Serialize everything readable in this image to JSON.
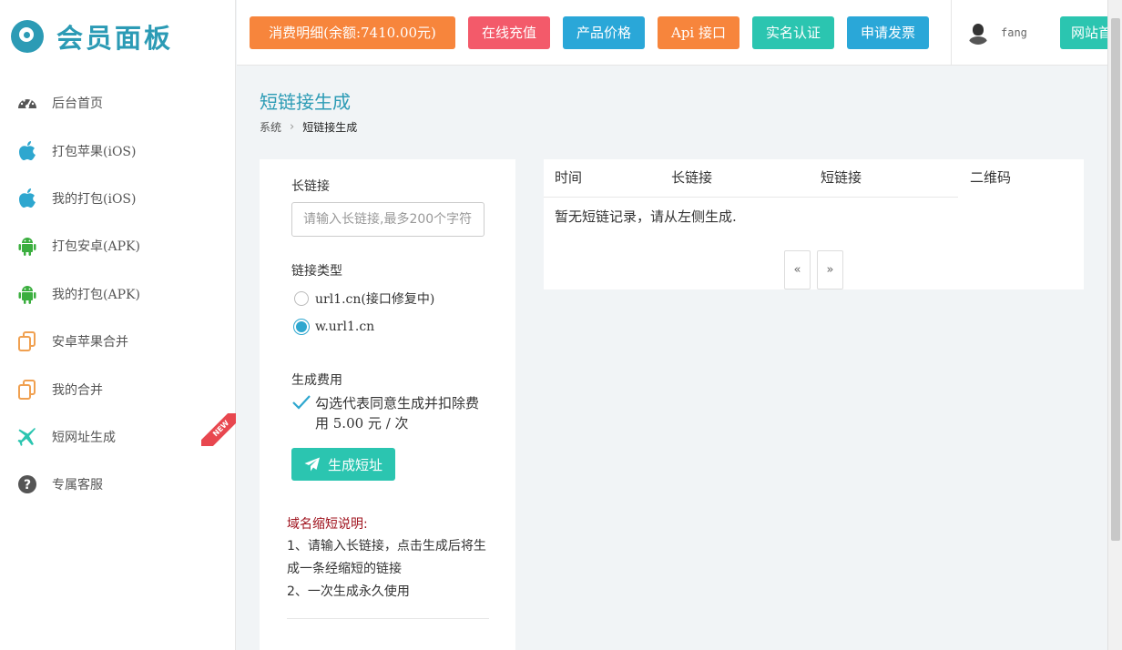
{
  "brand": {
    "title": "会员面板"
  },
  "sidebar": {
    "items": [
      {
        "label": "后台首页",
        "icon": "dashboard-icon"
      },
      {
        "label": "打包苹果(iOS)",
        "icon": "apple-icon"
      },
      {
        "label": "我的打包(iOS)",
        "icon": "apple-icon"
      },
      {
        "label": "打包安卓(APK)",
        "icon": "android-icon"
      },
      {
        "label": "我的打包(APK)",
        "icon": "android-icon"
      },
      {
        "label": "安卓苹果合并",
        "icon": "copy-icon"
      },
      {
        "label": "我的合并",
        "icon": "copy-icon"
      },
      {
        "label": "短网址生成",
        "icon": "plane-icon",
        "badge": "NEW"
      },
      {
        "label": "专属客服",
        "icon": "help-icon"
      }
    ]
  },
  "header": {
    "buttons": [
      {
        "label": "消费明细(余额:7410.00元)",
        "color": "#f7853c"
      },
      {
        "label": "在线充值",
        "color": "#f35a6a"
      },
      {
        "label": "产品价格",
        "color": "#2aa7d8"
      },
      {
        "label": "Api 接口",
        "color": "#f7853c"
      },
      {
        "label": "实名认证",
        "color": "#2bc5b0"
      },
      {
        "label": "申请发票",
        "color": "#2aa7d8"
      }
    ],
    "username": "fang",
    "site_button": "网站首页"
  },
  "page": {
    "title": "短链接生成",
    "breadcrumb": {
      "root": "系统",
      "current": "短链接生成"
    }
  },
  "form": {
    "long_url_label": "长链接",
    "long_url_placeholder": "请输入长链接,最多200个字符",
    "type_label": "链接类型",
    "type_options": [
      {
        "label": "url1.cn(接口修复中)",
        "checked": false
      },
      {
        "label": "w.url1.cn",
        "checked": true
      }
    ],
    "fee_label": "生成费用",
    "fee_check_text": "勾选代表同意生成并扣除费用 5.00 元 / 次",
    "submit_label": "生成短址",
    "note_title": "域名缩短说明:",
    "note_lines": [
      "1、请输入长链接，点击生成后将生成一条经缩短的链接",
      "2、一次生成永久使用"
    ]
  },
  "table": {
    "headers": [
      "时间",
      "长链接",
      "短链接",
      "二维码"
    ],
    "empty_text": "暂无短链记录，请从左侧生成.",
    "pager": {
      "prev": "«",
      "next": "»"
    }
  },
  "colors": {
    "accent": "#2c9bb5",
    "note_title": "#a0141f",
    "submit": "#2bc5b0"
  }
}
